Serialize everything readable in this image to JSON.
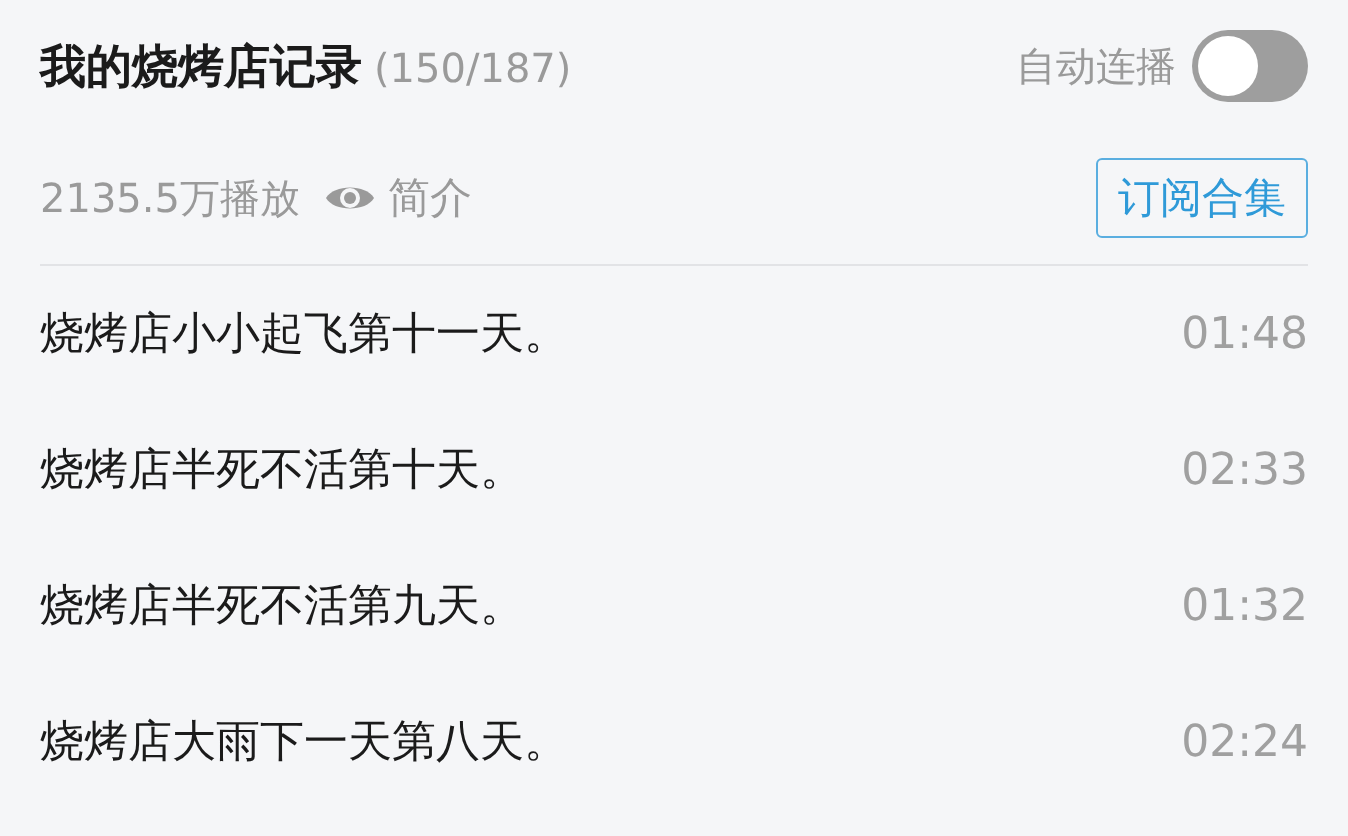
{
  "header": {
    "title": "我的烧烤店记录",
    "count": "(150/187)",
    "autoplay": {
      "label": "自动连播",
      "on": false
    }
  },
  "stats": {
    "plays": "2135.5万播放",
    "intro": "简介"
  },
  "subscribe_button": "订阅合集",
  "episodes": [
    {
      "title": "烧烤店小小起飞第十一天。",
      "duration": "01:48"
    },
    {
      "title": "烧烤店半死不活第十天。",
      "duration": "02:33"
    },
    {
      "title": "烧烤店半死不活第九天。",
      "duration": "01:32"
    },
    {
      "title": "烧烤店大雨下一天第八天。",
      "duration": "02:24"
    }
  ]
}
